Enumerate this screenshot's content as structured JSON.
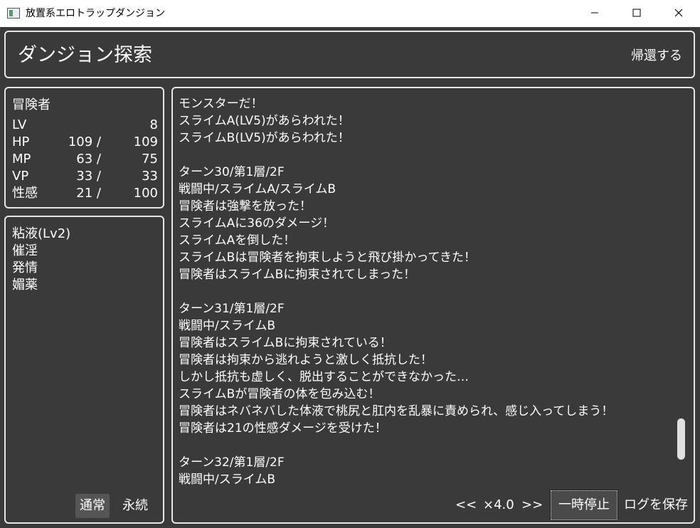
{
  "window": {
    "title": "放置系エロトラップダンジョン",
    "controls": {
      "minimize": "—",
      "maximize": "☐",
      "close": "✕"
    }
  },
  "header": {
    "title": "ダンジョン探索",
    "return_label": "帰還する"
  },
  "stats": {
    "name": "冒険者",
    "rows": [
      {
        "label": "LV",
        "current": "",
        "max": "8"
      },
      {
        "label": "HP",
        "current": "109 /",
        "max": "109"
      },
      {
        "label": "MP",
        "current": "63 /",
        "max": "75"
      },
      {
        "label": "VP",
        "current": "33 /",
        "max": "33"
      },
      {
        "label": "性感",
        "current": "21 /",
        "max": "100"
      }
    ]
  },
  "status_effects": {
    "items": [
      "粘液(Lv2)",
      "催淫",
      "発情",
      "媚薬"
    ],
    "mode_buttons": {
      "normal": "通常",
      "persistent": "永続"
    }
  },
  "log": {
    "lines": [
      "モンスターだ！",
      "スライムA(LV5)があらわれた！",
      "スライムB(LV5)があらわれた！",
      "",
      "ターン30/第1層/2F",
      "戦闘中/スライムA/スライムB",
      "冒険者は強撃を放った！",
      "スライムAに36のダメージ！",
      "スライムAを倒した！",
      "スライムBは冒険者を拘束しようと飛び掛かってきた！",
      "冒険者はスライムBに拘束されてしまった！",
      "",
      "ターン31/第1層/2F",
      "戦闘中/スライムB",
      "冒険者はスライムBに拘束されている！",
      "冒険者は拘束から逃れようと激しく抵抗した！",
      "しかし抵抗も虚しく、脱出することができなかった…",
      "スライムBが冒険者の体を包み込む！",
      "冒険者はネバネバした体液で桃尻と肛内を乱暴に責められ、感じ入ってしまう！",
      "冒険者は21の性感ダメージを受けた！",
      "",
      "ターン32/第1層/2F",
      "戦闘中/スライムB"
    ],
    "controls": {
      "speed_down": "<<",
      "speed": "×4.0",
      "speed_up": ">>",
      "pause": "一時停止",
      "save_log": "ログを保存"
    }
  },
  "colors": {
    "background": "#3a3a3a",
    "border": "#e6e6e6",
    "text": "#ffffff",
    "titlebar": "#ffffff"
  }
}
